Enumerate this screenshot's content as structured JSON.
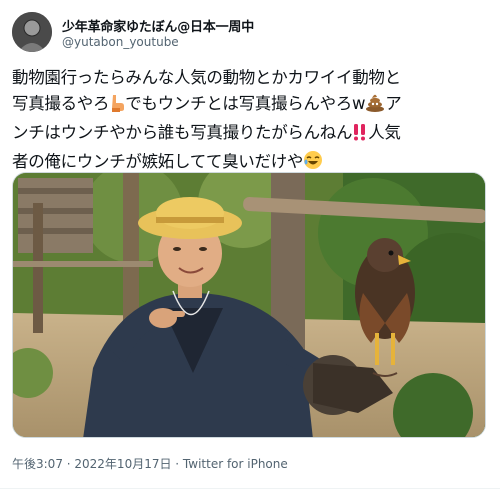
{
  "author": {
    "display_name": "少年革命家ゆたぼん@日本一周中",
    "handle": "@yutabon_youtube"
  },
  "tweet": {
    "lines": [
      {
        "text": "動物園行ったらみんな人気の動物とかカワイイ動物と"
      },
      {
        "text": "写真撮るやろ",
        "emoji": "pointing-finger-icon",
        "after": "でもウンチとは写真撮らんやろw",
        "emoji2": "poop-icon",
        "after2": "ア"
      },
      {
        "text": "ンチはウンチやから誰も写真撮りたがらんねん",
        "emoji": "double-exclamation-icon",
        "after": "人気"
      },
      {
        "text": "者の俺にウンチが嫉妬してて臭いだけや",
        "emoji": "laughing-face-icon"
      }
    ]
  },
  "media": {
    "description_icon": "photo-boy-with-hawk"
  },
  "meta": {
    "text": "午後3:07 · 2022年10月17日 · Twitter for iPhone"
  },
  "colors": {
    "text": "#0f1419",
    "secondary": "#536471",
    "border": "#cfd9de"
  }
}
